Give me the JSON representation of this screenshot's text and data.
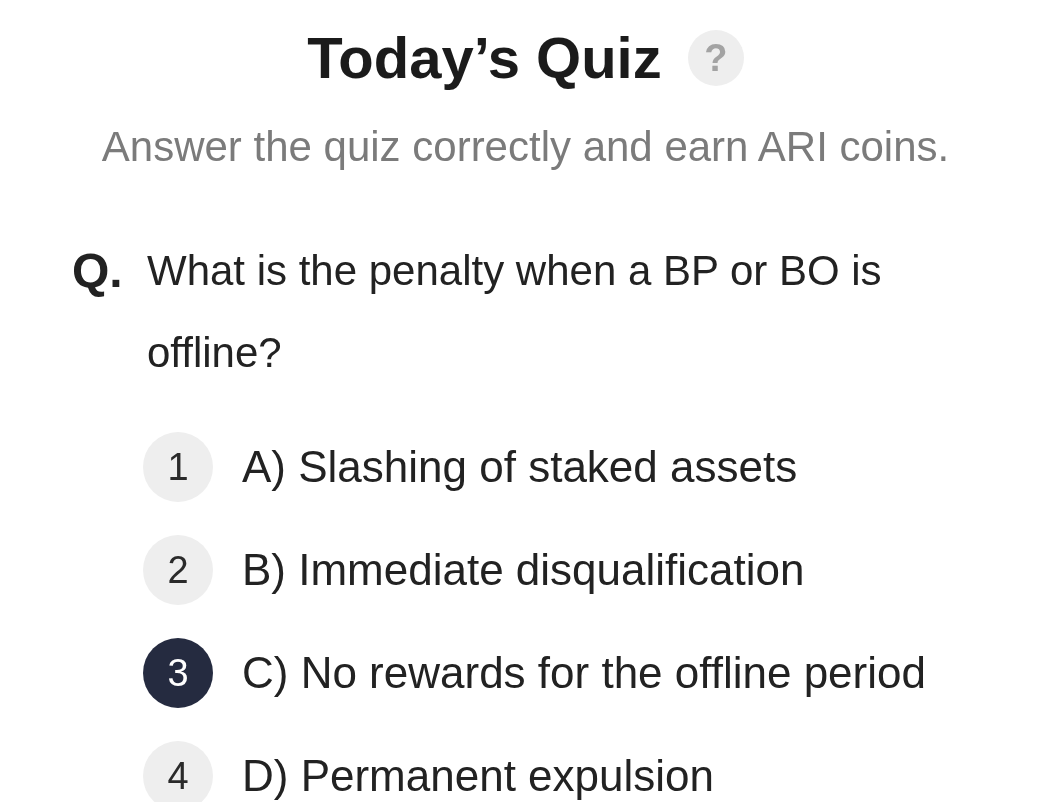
{
  "header": {
    "title": "Today’s Quiz",
    "help_button": "?",
    "subtitle": "Answer the quiz correctly and earn ARI coins."
  },
  "question": {
    "marker": "Q.",
    "text": "What is the penalty when a BP or BO is offline?"
  },
  "options": [
    {
      "number": "1",
      "label": "A) Slashing of staked assets",
      "selected": false
    },
    {
      "number": "2",
      "label": "B) Immediate disqualification",
      "selected": false
    },
    {
      "number": "3",
      "label": "C) No rewards for the offline period",
      "selected": true
    },
    {
      "number": "4",
      "label": "D) Permanent expulsion",
      "selected": false
    }
  ]
}
